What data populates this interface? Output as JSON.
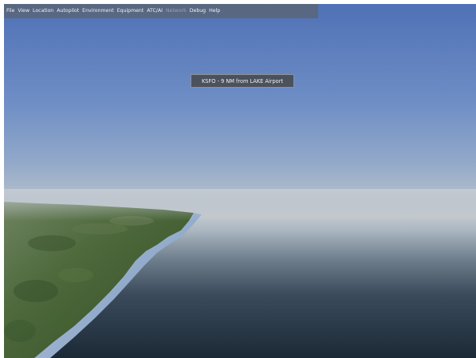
{
  "menubar": {
    "items": [
      {
        "label": "File",
        "enabled": true
      },
      {
        "label": "View",
        "enabled": true
      },
      {
        "label": "Location",
        "enabled": true
      },
      {
        "label": "Autopilot",
        "enabled": true
      },
      {
        "label": "Environment",
        "enabled": true
      },
      {
        "label": "Equipment",
        "enabled": true
      },
      {
        "label": "ATC/AI",
        "enabled": true
      },
      {
        "label": "Network",
        "enabled": false
      },
      {
        "label": "Debug",
        "enabled": true
      },
      {
        "label": "Help",
        "enabled": true
      }
    ]
  },
  "popup": {
    "text": "KSFO - 9 NM from LAKE Airport"
  },
  "colors": {
    "sky_top": "#5072b6",
    "sky_horizon": "#b7c2cc",
    "sea": "#1d2c3a",
    "land": "#4d6a3a",
    "shoreline": "#9fb7d6"
  }
}
